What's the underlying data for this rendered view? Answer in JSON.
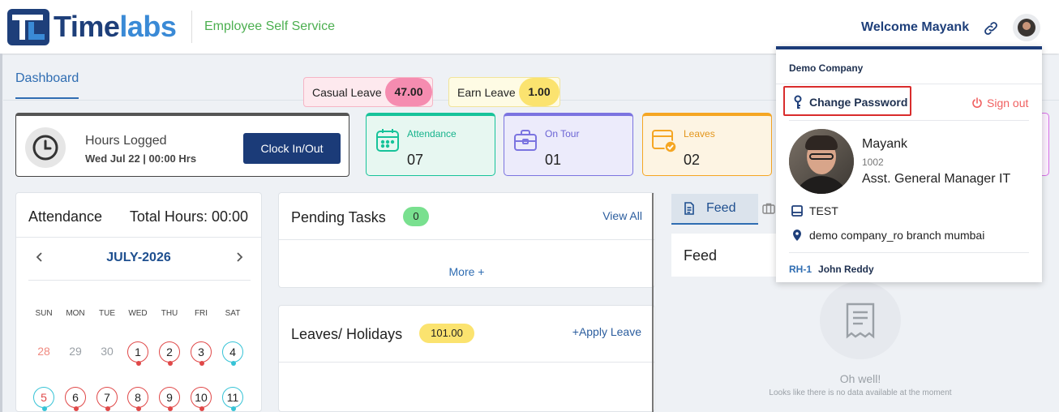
{
  "header": {
    "brand_prefix": "Time",
    "brand_suffix": "labs",
    "app_subtitle": "Employee Self Service",
    "welcome": "Welcome Mayank"
  },
  "tabs": [
    {
      "label": "Dashboard",
      "active": true
    }
  ],
  "hours_card": {
    "title": "Hours Logged",
    "subtitle": "Wed Jul 22 | 00:00 Hrs",
    "button": "Clock In/Out"
  },
  "stats": [
    {
      "label": "Attendance",
      "value": "07",
      "color": "#17c39a",
      "icon": "calendar-icon"
    },
    {
      "label": "On Tour",
      "value": "01",
      "color": "#7b74e0",
      "icon": "briefcase-icon"
    },
    {
      "label": "Leaves",
      "value": "02",
      "color": "#f5a623",
      "icon": "leave-approved-icon"
    }
  ],
  "attendance": {
    "title": "Attendance",
    "total_hours": "Total Hours: 00:00",
    "month": "JULY-2026",
    "weekdays": [
      "SUN",
      "MON",
      "TUE",
      "WED",
      "THU",
      "FRI",
      "SAT"
    ],
    "week1": [
      {
        "d": "28",
        "s": "hol"
      },
      {
        "d": "29",
        "s": "muted"
      },
      {
        "d": "30",
        "s": "muted"
      },
      {
        "d": "1",
        "s": "red"
      },
      {
        "d": "2",
        "s": "red"
      },
      {
        "d": "3",
        "s": "red"
      },
      {
        "d": "4",
        "s": "cyan"
      }
    ],
    "week2": [
      {
        "d": "5",
        "s": "cyan-redtx"
      },
      {
        "d": "6",
        "s": "red"
      },
      {
        "d": "7",
        "s": "red"
      },
      {
        "d": "8",
        "s": "red"
      },
      {
        "d": "9",
        "s": "red"
      },
      {
        "d": "10",
        "s": "red"
      },
      {
        "d": "11",
        "s": "cyan"
      }
    ]
  },
  "pending": {
    "title": "Pending Tasks",
    "count": "0",
    "view_all": "View All",
    "more": "More +"
  },
  "leaves": {
    "title": "Leaves/ Holidays",
    "total": "101.00",
    "apply": "Apply Leave",
    "apply_prefix": "+",
    "items": [
      {
        "name": "Casual Leave",
        "count": "47.00",
        "color": "#f58cb0"
      },
      {
        "name": "Earn Leave",
        "count": "1.00",
        "color": "#fbe36f"
      }
    ]
  },
  "feed": {
    "tab": "Feed",
    "title": "Feed",
    "empty_title": "Oh well!",
    "empty_text": "Looks like there is no data available at the moment"
  },
  "dropdown": {
    "company": "Demo Company",
    "change_password": "Change Password",
    "sign_out": "Sign out",
    "name": "Mayank",
    "emp_id": "1002",
    "role": "Asst. General Manager IT",
    "department": "TEST",
    "location": "demo company_ro branch mumbai",
    "reporting_key": "RH-1",
    "reporting_name": "John Reddy"
  }
}
